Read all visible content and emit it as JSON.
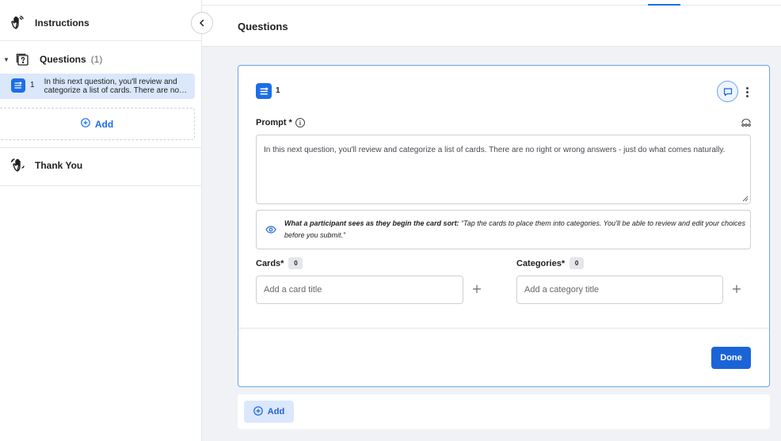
{
  "sidebar": {
    "instructions_label": "Instructions",
    "questions_label": "Questions",
    "questions_count": "(1)",
    "question_items": [
      {
        "number": "1",
        "text_line1": "In this next question, you'll review and",
        "text_line2": "categorize a list of cards. There are no right or wrong answers - just do what comes naturally."
      }
    ],
    "add_label": "Add",
    "thank_you_label": "Thank You"
  },
  "header": {
    "title": "Questions"
  },
  "question_card": {
    "number": "1",
    "prompt_label": "Prompt *",
    "prompt_value": "In this next question, you'll review and categorize a list of cards. There are no right or wrong answers - just do what comes naturally.",
    "preview_lead": "What a participant sees as they begin the card sort:",
    "preview_text": " “Tap the cards to place them into categories. You'll be able to review and edit your choices before you submit.”",
    "cards_label": "Cards*",
    "cards_count": "0",
    "cards_placeholder": "Add a card title",
    "categories_label": "Categories*",
    "categories_count": "0",
    "categories_placeholder": "Add a category title",
    "done_label": "Done"
  },
  "footer": {
    "add_label": "Add"
  },
  "colors": {
    "accent": "#1b64d8",
    "selected_bg": "#dbe7fb",
    "canvas_bg": "#f0f2f5"
  },
  "icons": [
    "waving-hand-icon",
    "question-box-icon",
    "card-sort-icon",
    "chevron-left-icon",
    "plus-circle-icon",
    "comment-icon",
    "kebab-icon",
    "info-icon",
    "ai-sparkle-icon",
    "eye-icon",
    "plus-icon"
  ]
}
